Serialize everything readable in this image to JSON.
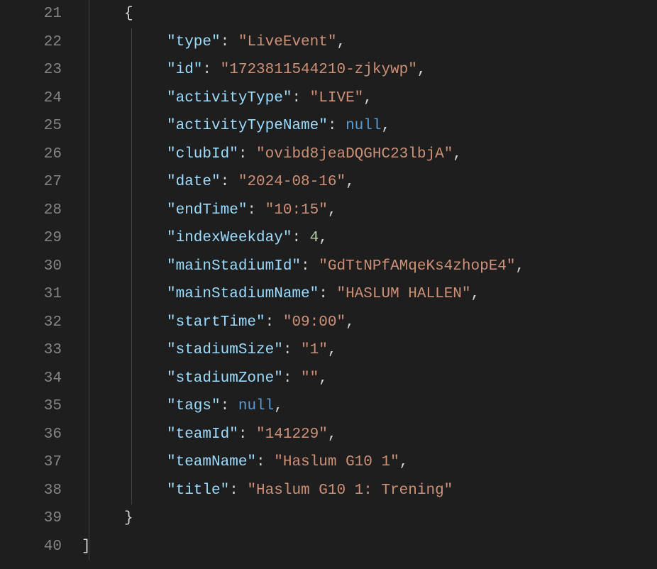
{
  "startLine": 21,
  "lines": [
    {
      "i": 21,
      "indent": 1,
      "guides": [
        1
      ],
      "tokens": [
        {
          "t": "{",
          "c": "tok-punct"
        }
      ]
    },
    {
      "i": 22,
      "indent": 2,
      "guides": [
        1,
        2
      ],
      "tokens": [
        {
          "t": "\"type\"",
          "c": "tok-key"
        },
        {
          "t": ": ",
          "c": "tok-punct"
        },
        {
          "t": "\"LiveEvent\"",
          "c": "tok-str"
        },
        {
          "t": ",",
          "c": "tok-punct"
        }
      ]
    },
    {
      "i": 23,
      "indent": 2,
      "guides": [
        1,
        2
      ],
      "tokens": [
        {
          "t": "\"id\"",
          "c": "tok-key"
        },
        {
          "t": ": ",
          "c": "tok-punct"
        },
        {
          "t": "\"1723811544210-zjkywp\"",
          "c": "tok-str"
        },
        {
          "t": ",",
          "c": "tok-punct"
        }
      ]
    },
    {
      "i": 24,
      "indent": 2,
      "guides": [
        1,
        2
      ],
      "tokens": [
        {
          "t": "\"activityType\"",
          "c": "tok-key"
        },
        {
          "t": ": ",
          "c": "tok-punct"
        },
        {
          "t": "\"LIVE\"",
          "c": "tok-str"
        },
        {
          "t": ",",
          "c": "tok-punct"
        }
      ]
    },
    {
      "i": 25,
      "indent": 2,
      "guides": [
        1,
        2
      ],
      "tokens": [
        {
          "t": "\"activityTypeName\"",
          "c": "tok-key"
        },
        {
          "t": ": ",
          "c": "tok-punct"
        },
        {
          "t": "null",
          "c": "tok-null"
        },
        {
          "t": ",",
          "c": "tok-punct"
        }
      ]
    },
    {
      "i": 26,
      "indent": 2,
      "guides": [
        1,
        2
      ],
      "tokens": [
        {
          "t": "\"clubId\"",
          "c": "tok-key"
        },
        {
          "t": ": ",
          "c": "tok-punct"
        },
        {
          "t": "\"ovibd8jeaDQGHC23lbjA\"",
          "c": "tok-str"
        },
        {
          "t": ",",
          "c": "tok-punct"
        }
      ]
    },
    {
      "i": 27,
      "indent": 2,
      "guides": [
        1,
        2
      ],
      "tokens": [
        {
          "t": "\"date\"",
          "c": "tok-key"
        },
        {
          "t": ": ",
          "c": "tok-punct"
        },
        {
          "t": "\"2024-08-16\"",
          "c": "tok-str"
        },
        {
          "t": ",",
          "c": "tok-punct"
        }
      ]
    },
    {
      "i": 28,
      "indent": 2,
      "guides": [
        1,
        2
      ],
      "tokens": [
        {
          "t": "\"endTime\"",
          "c": "tok-key"
        },
        {
          "t": ": ",
          "c": "tok-punct"
        },
        {
          "t": "\"10:15\"",
          "c": "tok-str"
        },
        {
          "t": ",",
          "c": "tok-punct"
        }
      ]
    },
    {
      "i": 29,
      "indent": 2,
      "guides": [
        1,
        2
      ],
      "tokens": [
        {
          "t": "\"indexWeekday\"",
          "c": "tok-key"
        },
        {
          "t": ": ",
          "c": "tok-punct"
        },
        {
          "t": "4",
          "c": "tok-num"
        },
        {
          "t": ",",
          "c": "tok-punct"
        }
      ]
    },
    {
      "i": 30,
      "indent": 2,
      "guides": [
        1,
        2
      ],
      "tokens": [
        {
          "t": "\"mainStadiumId\"",
          "c": "tok-key"
        },
        {
          "t": ": ",
          "c": "tok-punct"
        },
        {
          "t": "\"GdTtNPfAMqeKs4zhopE4\"",
          "c": "tok-str"
        },
        {
          "t": ",",
          "c": "tok-punct"
        }
      ]
    },
    {
      "i": 31,
      "indent": 2,
      "guides": [
        1,
        2
      ],
      "tokens": [
        {
          "t": "\"mainStadiumName\"",
          "c": "tok-key"
        },
        {
          "t": ": ",
          "c": "tok-punct"
        },
        {
          "t": "\"HASLUM HALLEN\"",
          "c": "tok-str"
        },
        {
          "t": ",",
          "c": "tok-punct"
        }
      ]
    },
    {
      "i": 32,
      "indent": 2,
      "guides": [
        1,
        2
      ],
      "tokens": [
        {
          "t": "\"startTime\"",
          "c": "tok-key"
        },
        {
          "t": ": ",
          "c": "tok-punct"
        },
        {
          "t": "\"09:00\"",
          "c": "tok-str"
        },
        {
          "t": ",",
          "c": "tok-punct"
        }
      ]
    },
    {
      "i": 33,
      "indent": 2,
      "guides": [
        1,
        2
      ],
      "tokens": [
        {
          "t": "\"stadiumSize\"",
          "c": "tok-key"
        },
        {
          "t": ": ",
          "c": "tok-punct"
        },
        {
          "t": "\"1\"",
          "c": "tok-str"
        },
        {
          "t": ",",
          "c": "tok-punct"
        }
      ]
    },
    {
      "i": 34,
      "indent": 2,
      "guides": [
        1,
        2
      ],
      "tokens": [
        {
          "t": "\"stadiumZone\"",
          "c": "tok-key"
        },
        {
          "t": ": ",
          "c": "tok-punct"
        },
        {
          "t": "\"\"",
          "c": "tok-str"
        },
        {
          "t": ",",
          "c": "tok-punct"
        }
      ]
    },
    {
      "i": 35,
      "indent": 2,
      "guides": [
        1,
        2
      ],
      "tokens": [
        {
          "t": "\"tags\"",
          "c": "tok-key"
        },
        {
          "t": ": ",
          "c": "tok-punct"
        },
        {
          "t": "null",
          "c": "tok-null"
        },
        {
          "t": ",",
          "c": "tok-punct"
        }
      ]
    },
    {
      "i": 36,
      "indent": 2,
      "guides": [
        1,
        2
      ],
      "tokens": [
        {
          "t": "\"teamId\"",
          "c": "tok-key"
        },
        {
          "t": ": ",
          "c": "tok-punct"
        },
        {
          "t": "\"141229\"",
          "c": "tok-str"
        },
        {
          "t": ",",
          "c": "tok-punct"
        }
      ]
    },
    {
      "i": 37,
      "indent": 2,
      "guides": [
        1,
        2
      ],
      "tokens": [
        {
          "t": "\"teamName\"",
          "c": "tok-key"
        },
        {
          "t": ": ",
          "c": "tok-punct"
        },
        {
          "t": "\"Haslum G10 1\"",
          "c": "tok-str"
        },
        {
          "t": ",",
          "c": "tok-punct"
        }
      ]
    },
    {
      "i": 38,
      "indent": 2,
      "guides": [
        1,
        2
      ],
      "tokens": [
        {
          "t": "\"title\"",
          "c": "tok-key"
        },
        {
          "t": ": ",
          "c": "tok-punct"
        },
        {
          "t": "\"Haslum G10 1: Trening\"",
          "c": "tok-str"
        }
      ]
    },
    {
      "i": 39,
      "indent": 1,
      "guides": [
        1
      ],
      "tokens": [
        {
          "t": "}",
          "c": "tok-punct"
        }
      ]
    },
    {
      "i": 40,
      "indent": 0,
      "guides": [
        1
      ],
      "tokens": [
        {
          "t": "]",
          "c": "tok-punct"
        }
      ]
    }
  ]
}
